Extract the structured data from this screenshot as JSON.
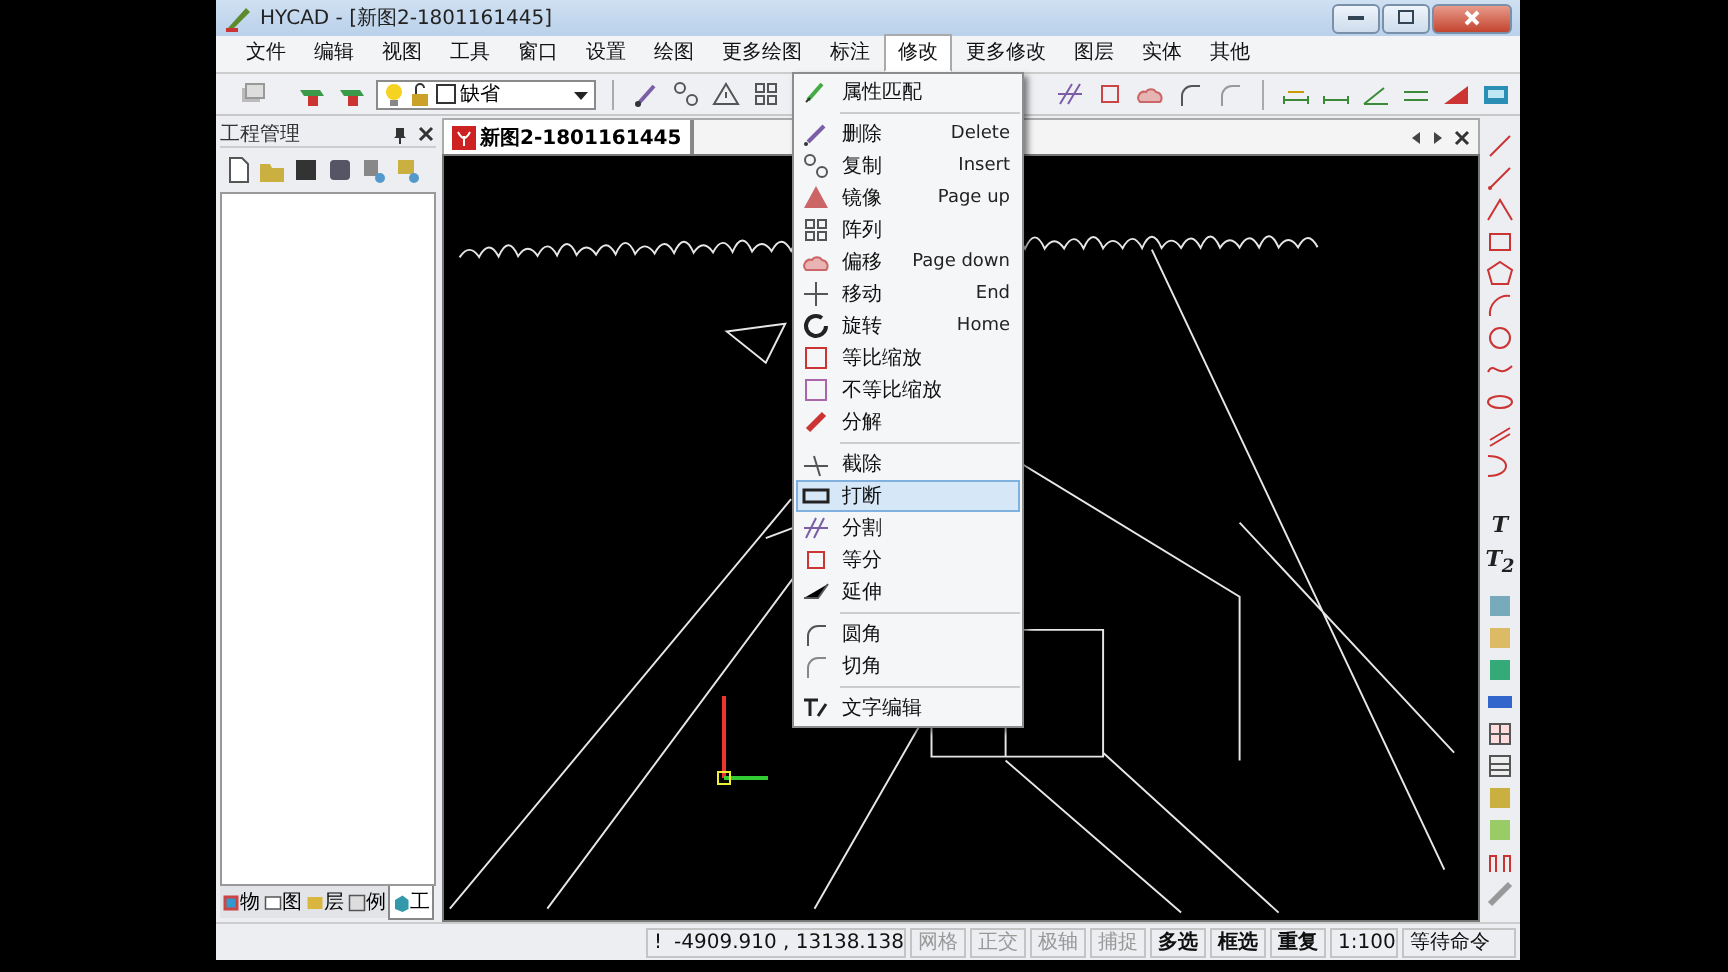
{
  "window": {
    "title": "HYCAD - [新图2-1801161445]"
  },
  "menu_bar": [
    {
      "label": "文件",
      "selected": false
    },
    {
      "label": "编辑",
      "selected": false
    },
    {
      "label": "视图",
      "selected": false
    },
    {
      "label": "工具",
      "selected": false
    },
    {
      "label": "窗口",
      "selected": false
    },
    {
      "label": "设置",
      "selected": false
    },
    {
      "label": "绘图",
      "selected": false
    },
    {
      "label": "更多绘图",
      "selected": false
    },
    {
      "label": "标注",
      "selected": false
    },
    {
      "label": "修改",
      "selected": true
    },
    {
      "label": "更多修改",
      "selected": false
    },
    {
      "label": "图层",
      "selected": false
    },
    {
      "label": "实体",
      "selected": false
    },
    {
      "label": "其他",
      "selected": false
    }
  ],
  "toolbar": {
    "layer": "缺省"
  },
  "project_panel": {
    "title": "工程管理",
    "tabs": [
      {
        "label": "物",
        "selected": false
      },
      {
        "label": "图",
        "selected": false
      },
      {
        "label": "层",
        "selected": false
      },
      {
        "label": "例",
        "selected": false
      },
      {
        "label": "工",
        "selected": true
      }
    ]
  },
  "document_tab": {
    "title": "新图2-1801161445"
  },
  "dropdown_menu": {
    "items": [
      {
        "kind": "item",
        "label": "属性匹配",
        "selected": false
      },
      {
        "kind": "separator"
      },
      {
        "kind": "item",
        "label": "删除",
        "shortcut": "Delete",
        "selected": false
      },
      {
        "kind": "item",
        "label": "复制",
        "shortcut": "Insert",
        "selected": false
      },
      {
        "kind": "item",
        "label": "镜像",
        "shortcut": "Page up",
        "selected": false
      },
      {
        "kind": "item",
        "label": "阵列",
        "selected": false
      },
      {
        "kind": "item",
        "label": "偏移",
        "shortcut": "Page down",
        "selected": false
      },
      {
        "kind": "item",
        "label": "移动",
        "shortcut": "End",
        "selected": false
      },
      {
        "kind": "item",
        "label": "旋转",
        "shortcut": "Home",
        "selected": false
      },
      {
        "kind": "item",
        "label": "等比缩放",
        "selected": false
      },
      {
        "kind": "item",
        "label": "不等比缩放",
        "selected": false
      },
      {
        "kind": "item",
        "label": "分解",
        "selected": false
      },
      {
        "kind": "separator"
      },
      {
        "kind": "item",
        "label": "截除",
        "selected": false
      },
      {
        "kind": "item",
        "label": "打断",
        "selected": true
      },
      {
        "kind": "item",
        "label": "分割",
        "selected": false
      },
      {
        "kind": "item",
        "label": "等分",
        "selected": false
      },
      {
        "kind": "item",
        "label": "延伸",
        "selected": false
      },
      {
        "kind": "separator"
      },
      {
        "kind": "item",
        "label": "圆角",
        "selected": false
      },
      {
        "kind": "item",
        "label": "切角",
        "selected": false
      },
      {
        "kind": "separator"
      },
      {
        "kind": "item",
        "label": "文字编辑",
        "selected": false
      }
    ]
  },
  "right_toolbar": {
    "text_tools": [
      "T",
      "T$_{2}$"
    ]
  },
  "status_bar": {
    "flag": "!",
    "coordinates": "-4909.910 , 13138.138",
    "toggles": [
      {
        "label": "网格",
        "on": false
      },
      {
        "label": "正交",
        "on": false
      },
      {
        "label": "极轴",
        "on": false
      },
      {
        "label": "捕捉",
        "on": false
      },
      {
        "label": "多选",
        "on": true
      },
      {
        "label": "框选",
        "on": true
      },
      {
        "label": "重复",
        "on": true
      }
    ],
    "scale": "1:100",
    "prompt": "等待命令"
  }
}
